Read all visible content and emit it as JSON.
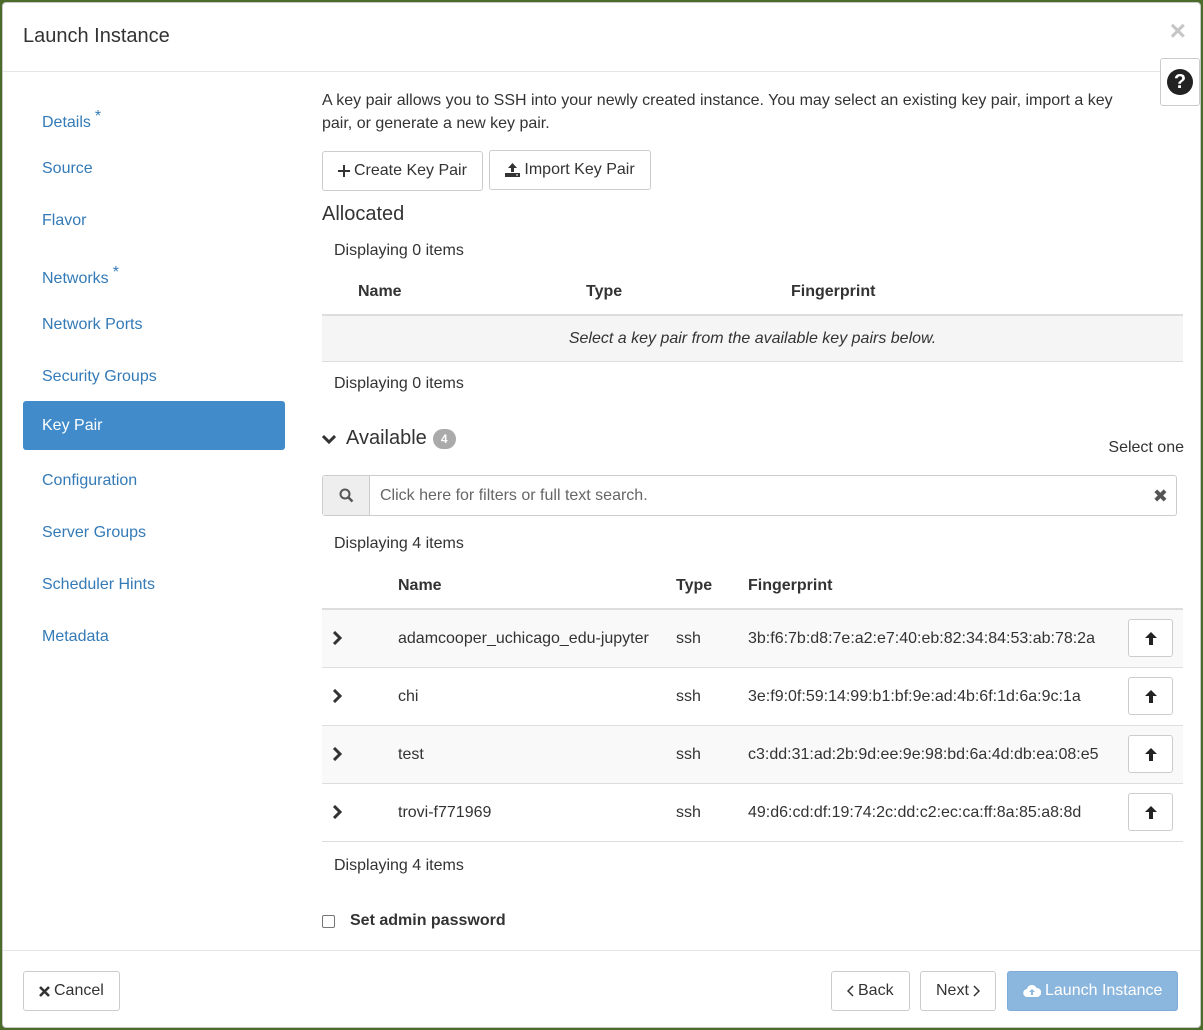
{
  "modal": {
    "title": "Launch Instance",
    "close_symbol": "×",
    "help_symbol": "?"
  },
  "sidebar": {
    "items": [
      {
        "label": "Details",
        "required": true
      },
      {
        "label": "Source",
        "required": false
      },
      {
        "label": "Flavor",
        "required": false
      },
      {
        "label": "Networks",
        "required": true
      },
      {
        "label": "Network Ports",
        "required": false
      },
      {
        "label": "Security Groups",
        "required": false
      },
      {
        "label": "Key Pair",
        "required": false,
        "active": true
      },
      {
        "label": "Configuration",
        "required": false
      },
      {
        "label": "Server Groups",
        "required": false
      },
      {
        "label": "Scheduler Hints",
        "required": false
      },
      {
        "label": "Metadata",
        "required": false
      }
    ],
    "required_marker": "*"
  },
  "content": {
    "description": "A key pair allows you to SSH into your newly created instance. You may select an existing key pair, import a key pair, or generate a new key pair.",
    "create_btn": "Create Key Pair",
    "import_btn": "Import Key Pair",
    "allocated": {
      "title": "Allocated",
      "count_top": "Displaying 0 items",
      "count_bottom": "Displaying 0 items",
      "columns": [
        "Name",
        "Type",
        "Fingerprint"
      ],
      "empty_message": "Select a key pair from the available key pairs below."
    },
    "available": {
      "title": "Available",
      "badge": "4",
      "select_hint": "Select one",
      "search_placeholder": "Click here for filters or full text search.",
      "clear_symbol": "✖",
      "count_top": "Displaying 4 items",
      "count_bottom": "Displaying 4 items",
      "columns": [
        "Name",
        "Type",
        "Fingerprint"
      ],
      "rows": [
        {
          "name": "adamcooper_uchicago_edu-jupyter",
          "type": "ssh",
          "fingerprint": "3b:f6:7b:d8:7e:a2:e7:40:eb:82:34:84:53:ab:78:2a"
        },
        {
          "name": "chi",
          "type": "ssh",
          "fingerprint": "3e:f9:0f:59:14:99:b1:bf:9e:ad:4b:6f:1d:6a:9c:1a"
        },
        {
          "name": "test",
          "type": "ssh",
          "fingerprint": "c3:dd:31:ad:2b:9d:ee:9e:98:bd:6a:4d:db:ea:08:e5"
        },
        {
          "name": "trovi-f771969",
          "type": "ssh",
          "fingerprint": "49:d6:cd:df:19:74:2c:dd:c2:ec:ca:ff:8a:85:a8:8d"
        }
      ]
    },
    "admin_password_label": "Set admin password"
  },
  "footer": {
    "cancel": "Cancel",
    "back": "Back",
    "next": "Next",
    "launch": "Launch Instance"
  },
  "colors": {
    "link": "#337ab7",
    "active_nav": "#428bca",
    "launch_disabled": "#8bb6dd"
  }
}
